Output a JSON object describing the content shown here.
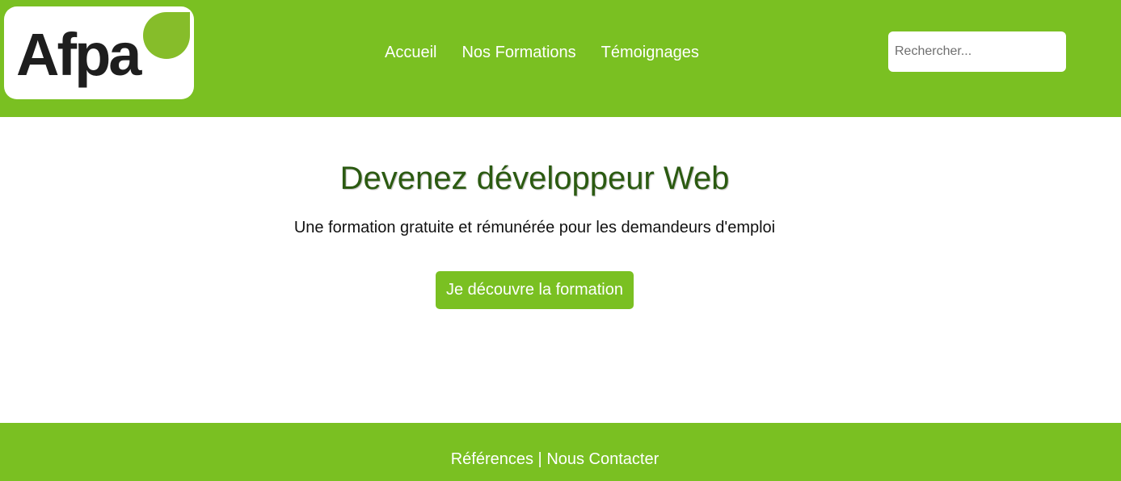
{
  "header": {
    "logo": {
      "text": "Afpa",
      "leaf_color": "#86bd2a"
    },
    "nav": [
      {
        "label": "Accueil"
      },
      {
        "label": "Nos Formations"
      },
      {
        "label": "Témoignages"
      }
    ],
    "search": {
      "placeholder": "Rechercher...",
      "value": ""
    }
  },
  "hero": {
    "title": "Devenez développeur Web",
    "subtitle": "Une formation gratuite et rémunérée pour les demandeurs d'emploi",
    "cta_label": "Je découvre la formation"
  },
  "footer": {
    "links": [
      {
        "label": "Références"
      },
      {
        "label": "Nous Contacter"
      }
    ],
    "separator": "|"
  },
  "colors": {
    "brand_green": "#7ac022",
    "title_green": "#2b5a11",
    "white": "#ffffff"
  }
}
